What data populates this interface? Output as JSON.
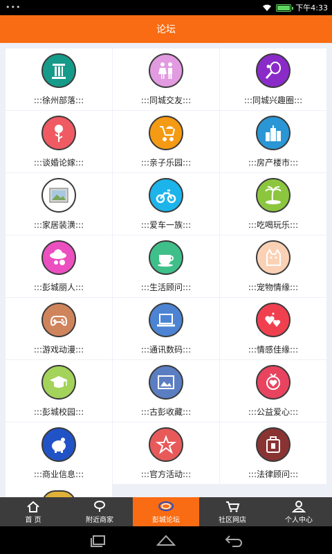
{
  "status": {
    "dots": "•••",
    "time": "下午4:33"
  },
  "header": {
    "title": "论坛"
  },
  "forums": [
    {
      "label": ":::徐州部落:::",
      "color": "#169b8b",
      "icon": "pillar-icon"
    },
    {
      "label": ":::同城交友:::",
      "color": "#e29ae0",
      "icon": "couple-icon"
    },
    {
      "label": ":::同城兴趣圈:::",
      "color": "#8a2bc9",
      "icon": "tennis-icon"
    },
    {
      "label": ":::谈婚论嫁:::",
      "color": "#ef5a63",
      "icon": "rose-icon"
    },
    {
      "label": ":::亲子乐园:::",
      "color": "#f59a13",
      "icon": "stroller-icon"
    },
    {
      "label": ":::房产楼市:::",
      "color": "#2a96d5",
      "icon": "buildings-icon"
    },
    {
      "label": ":::家居装潢:::",
      "color": "#ffffff",
      "icon": "picture-frame-icon"
    },
    {
      "label": ":::爱车一族:::",
      "color": "#1cb4ea",
      "icon": "motorbike-icon"
    },
    {
      "label": ":::吃喝玩乐:::",
      "color": "#8cc63f",
      "icon": "palm-island-icon"
    },
    {
      "label": ":::彭城丽人:::",
      "color": "#ec4fc0",
      "icon": "lady-hat-icon"
    },
    {
      "label": ":::生活顾问:::",
      "color": "#3fbf8a",
      "icon": "coffee-cup-icon"
    },
    {
      "label": ":::宠物情缘:::",
      "color": "#fbd1b5",
      "icon": "cat-icon"
    },
    {
      "label": ":::游戏动漫:::",
      "color": "#d0845c",
      "icon": "gamepad-icon"
    },
    {
      "label": ":::通讯数码:::",
      "color": "#4c84d3",
      "icon": "laptop-icon"
    },
    {
      "label": ":::情感佳缘:::",
      "color": "#f0404f",
      "icon": "hearts-icon"
    },
    {
      "label": ":::彭城校园:::",
      "color": "#a3d35a",
      "icon": "graduation-cap-icon"
    },
    {
      "label": ":::古彭收藏:::",
      "color": "#5b7ec2",
      "icon": "image-frame-icon"
    },
    {
      "label": ":::公益爱心:::",
      "color": "#e8445f",
      "icon": "heart-medal-icon"
    },
    {
      "label": ":::商业信息:::",
      "color": "#2153c7",
      "icon": "piggy-bank-icon"
    },
    {
      "label": ":::官方活动:::",
      "color": "#e85a5a",
      "icon": "star-icon"
    },
    {
      "label": ":::法律顾问:::",
      "color": "#8a3333",
      "icon": "briefcase-icon"
    }
  ],
  "tabs": [
    {
      "label": "首  页",
      "icon": "home-icon",
      "active": false
    },
    {
      "label": "附近商家",
      "icon": "location-icon",
      "active": false
    },
    {
      "label": "彭城论坛",
      "icon": "swirl-logo-icon",
      "active": true
    },
    {
      "label": "社区网店",
      "icon": "cart-icon",
      "active": false
    },
    {
      "label": "个人中心",
      "icon": "user-icon",
      "active": false
    }
  ],
  "colors": {
    "accent": "#f96c13",
    "tabbar": "#3c3c3c",
    "background": "#eef0f7"
  }
}
